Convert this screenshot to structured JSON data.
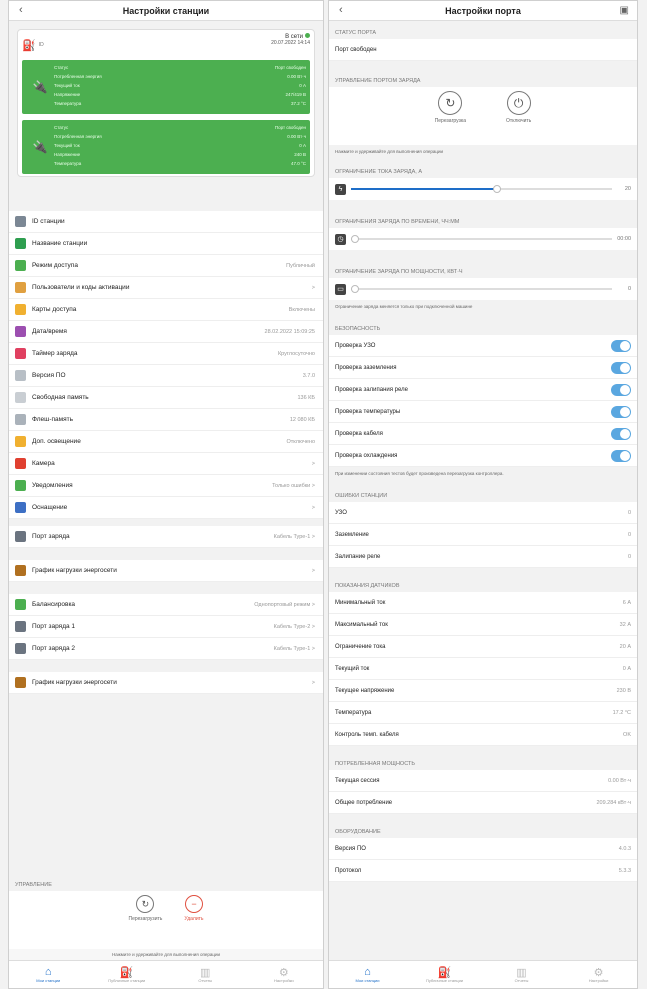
{
  "left": {
    "title": "Настройки станции",
    "card": {
      "id_label": "ID",
      "online": "В сети",
      "datetime": "20.07.2022 14:14",
      "port1": [
        {
          "label": "Статус",
          "value": "Порт свободен"
        },
        {
          "label": "Потребленная энергия",
          "value": "0.00 Вт·ч"
        },
        {
          "label": "Текущий ток",
          "value": "0 А"
        },
        {
          "label": "Напряжение",
          "value": "247/419 В"
        },
        {
          "label": "Температура",
          "value": "37.2 °С"
        }
      ],
      "port2": [
        {
          "label": "Статус",
          "value": "Порт свободен"
        },
        {
          "label": "Потребленная энергия",
          "value": "0.00 Вт·ч"
        },
        {
          "label": "Текущий ток",
          "value": "0 А"
        },
        {
          "label": "Напряжение",
          "value": "240 В"
        },
        {
          "label": "Температура",
          "value": "47.0 °С"
        }
      ]
    },
    "group1": [
      {
        "label": "ID станции",
        "value": "",
        "color": "#7b8794"
      },
      {
        "label": "Название станции",
        "value": "",
        "color": "#2e9e4f"
      },
      {
        "label": "Режим доступа",
        "value": "Публичный",
        "color": "#4caf50"
      },
      {
        "label": "Пользователи и коды активации",
        "value": ">",
        "color": "#e0a040"
      },
      {
        "label": "Карты доступа",
        "value": "Включены",
        "color": "#f0b030"
      },
      {
        "label": "Дата/время",
        "value": "28.02.2022 15:09:25",
        "color": "#9c4fb0"
      },
      {
        "label": "Таймер заряда",
        "value": "Круглосуточно",
        "color": "#e04060"
      },
      {
        "label": "Версия ПО",
        "value": "3.7.0",
        "color": "#b8bfc6"
      },
      {
        "label": "Свободная память",
        "value": "136 КБ",
        "color": "#c9ced3"
      },
      {
        "label": "Флеш-память",
        "value": "12 080 КБ",
        "color": "#aab2ba"
      },
      {
        "label": "Доп. освещение",
        "value": "Отключено",
        "color": "#f0b030"
      },
      {
        "label": "Камера",
        "value": ">",
        "color": "#e04030"
      },
      {
        "label": "Уведомления",
        "value": "Только ошибки >",
        "color": "#4caf50"
      },
      {
        "label": "Оснащение",
        "value": ">",
        "color": "#3d6fc4"
      }
    ],
    "group2": [
      {
        "label": "Порт заряда",
        "value": "Кабель Type-1 >",
        "color": "#6b7480"
      }
    ],
    "group3": [
      {
        "label": "График нагрузки энергосети",
        "value": ">",
        "color": "#b07020"
      }
    ],
    "group4": [
      {
        "label": "Балансировка",
        "value": "Однопортовый режим >",
        "color": "#4caf50"
      },
      {
        "label": "Порт заряда 1",
        "value": "Кабель Type-2 >",
        "color": "#6b7480"
      },
      {
        "label": "Порт заряда 2",
        "value": "Кабель Type-1 >",
        "color": "#6b7480"
      }
    ],
    "group5": [
      {
        "label": "График нагрузки энергосети",
        "value": ">",
        "color": "#b07020"
      }
    ],
    "management": {
      "title": "УПРАВЛЕНИЕ",
      "restart": "Перезагрузить",
      "delete": "Удалить",
      "hint": "Нажмите и удерживайте для выполнения операции"
    }
  },
  "right": {
    "title": "Настройки порта",
    "port_status_title": "СТАТУС ПОРТА",
    "port_status": "Порт свободен",
    "port_control_title": "УПРАВЛЕНИЕ ПОРТОМ ЗАРЯДА",
    "restart": "Перезагрузка",
    "disconnect": "Отключить",
    "control_hint": "Нажмите и удерживайте для выполнения операции",
    "current_limit_title": "ОГРАНИЧЕНИЕ ТОКА ЗАРЯДА, А",
    "current_limit_value": "20",
    "current_limit_fraction": 0.56,
    "time_limit_title": "ОГРАНИЧЕНИЯ ЗАРЯДА ПО ВРЕМЕНИ, ЧЧ:ММ",
    "time_limit_value": "00:00",
    "power_limit_title": "ОГРАНИЧЕНИЕ ЗАРЯДА ПО МОЩНОСТИ, КВТ·Ч",
    "power_limit_value": "0",
    "limit_note": "Ограничение заряда меняется только при подключенной машине",
    "security_title": "БЕЗОПАСНОСТЬ",
    "security": [
      {
        "label": "Проверка УЗО"
      },
      {
        "label": "Проверка заземления"
      },
      {
        "label": "Проверка залипания реле"
      },
      {
        "label": "Проверка температуры"
      },
      {
        "label": "Проверка кабеля"
      },
      {
        "label": "Проверка охлаждения"
      }
    ],
    "security_note": "При изменении состояния тестов будет произведена перезагрузка контроллера.",
    "errors_title": "ОШИБКИ СТАНЦИИ",
    "errors": [
      {
        "label": "УЗО",
        "value": "0"
      },
      {
        "label": "Заземление",
        "value": "0"
      },
      {
        "label": "Залипание реле",
        "value": "0"
      }
    ],
    "sensors_title": "ПОКАЗАНИЯ ДАТЧИКОВ",
    "sensors": [
      {
        "label": "Минимальный ток",
        "value": "6 А"
      },
      {
        "label": "Максимальный ток",
        "value": "32 А"
      },
      {
        "label": "Ограничение тока",
        "value": "20 А"
      },
      {
        "label": "Текущий ток",
        "value": "0 А"
      },
      {
        "label": "Текущее напряжение",
        "value": "230 В"
      },
      {
        "label": "Температура",
        "value": "17.2 °С"
      },
      {
        "label": "Контроль темп. кабеля",
        "value": "OK"
      }
    ],
    "power_title": "ПОТРЕБЛЕННАЯ МОЩНОСТЬ",
    "power": [
      {
        "label": "Текущая сессия",
        "value": "0.00 Вт·ч"
      },
      {
        "label": "Общее потребление",
        "value": "209.284 кВт·ч"
      }
    ],
    "hw_title": "ОБОРУДОВАНИЕ",
    "hw": [
      {
        "label": "Версия ПО",
        "value": "4.0.3"
      },
      {
        "label": "Протокол",
        "value": "5.3.3"
      }
    ]
  },
  "tabs": [
    {
      "label": "Мои станции"
    },
    {
      "label": "Публичные станции"
    },
    {
      "label": "Отчеты"
    },
    {
      "label": "Настройки"
    }
  ],
  "colors": {
    "accent": "#1e6ec8",
    "green": "#4caf50",
    "toggle": "#5aa7e0",
    "danger": "#e05040"
  }
}
